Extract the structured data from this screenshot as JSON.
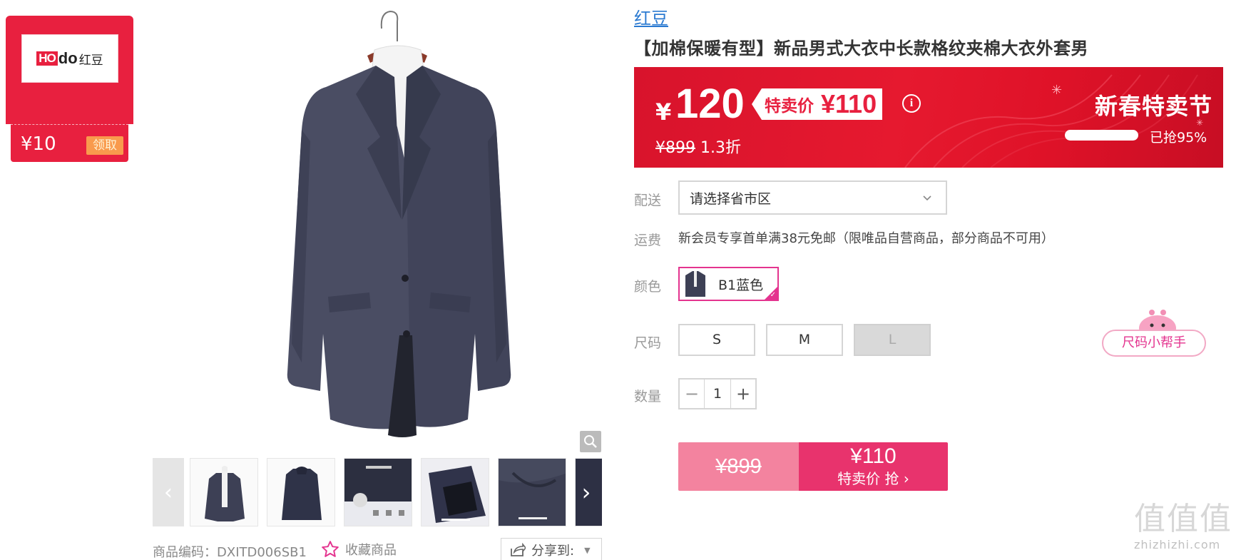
{
  "coupon": {
    "logo_prefix": "HO",
    "logo_suffix": "do",
    "logo_cn": "红豆",
    "amount": "¥10",
    "claim_label": "领取"
  },
  "gallery": {
    "thumbnails": [
      "model-front",
      "coat-back",
      "fabric-detail",
      "lining-detail",
      "collar-detail",
      "partial"
    ],
    "product_code": "商品编码：DXITD006SB1",
    "favorite_label": "收藏商品",
    "share_label": "分享到:"
  },
  "product": {
    "brand": "红豆",
    "title": "【加棉保暖有型】新品男式大衣中长款格纹夹棉大衣外套男"
  },
  "price_banner": {
    "currency": "¥",
    "price": "120",
    "special_label": "特卖价",
    "special_price": "¥110",
    "info_icon": "i",
    "original_price": "¥899",
    "discount": "1.3折",
    "festival_title": "新春特卖节",
    "sold_percent": 0.95,
    "sold_text": "已抢95%"
  },
  "delivery": {
    "label": "配送",
    "placeholder": "请选择省市区"
  },
  "shipping": {
    "label": "运费",
    "text": "新会员专享首单满38元免邮（限唯品自营商品，部分商品不可用）"
  },
  "color": {
    "label": "颜色",
    "option": "B1蓝色"
  },
  "size": {
    "label": "尺码",
    "options": [
      "S",
      "M",
      "L"
    ],
    "helper_label": "尺码小帮手"
  },
  "quantity": {
    "label": "数量",
    "minus": "−",
    "value": "1",
    "plus": "+"
  },
  "buy": {
    "original_price": "¥899",
    "special_price": "¥110",
    "action_label": "特卖价 抢 ›"
  },
  "watermark": {
    "logo": "值",
    "url": "zhizhizhi.com"
  },
  "colors": {
    "brand_red": "#e8203f",
    "accent_pink": "#e4348f",
    "link_blue": "#2b7ad1"
  }
}
